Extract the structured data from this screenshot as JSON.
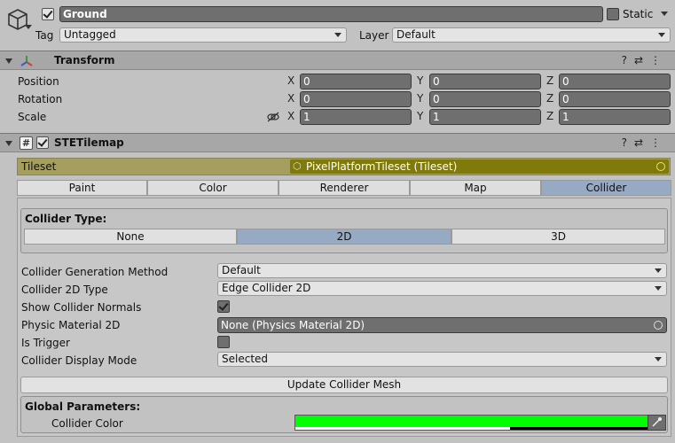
{
  "header": {
    "object_active": true,
    "object_name": "Ground",
    "static_label": "Static",
    "static_checked": false,
    "tag_label": "Tag",
    "tag_value": "Untagged",
    "layer_label": "Layer",
    "layer_value": "Default"
  },
  "transform": {
    "title": "Transform",
    "rows": [
      {
        "label": "Position",
        "x": "0",
        "y": "0",
        "z": "0"
      },
      {
        "label": "Rotation",
        "x": "0",
        "y": "0",
        "z": "0"
      },
      {
        "label": "Scale",
        "x": "1",
        "y": "1",
        "z": "1"
      }
    ],
    "axis_x": "X",
    "axis_y": "Y",
    "axis_z": "Z"
  },
  "stetilemap": {
    "title": "STETilemap",
    "enabled": true,
    "tileset_label": "Tileset",
    "tileset_value": "PixelPlatformTileset (Tileset)",
    "tabs": [
      "Paint",
      "Color",
      "Renderer",
      "Map",
      "Collider"
    ],
    "active_tab": "Collider",
    "collider_type_label": "Collider Type:",
    "collider_types": [
      "None",
      "2D",
      "3D"
    ],
    "active_collider_type": "2D",
    "props": {
      "generation_method_label": "Collider Generation Method",
      "generation_method_value": "Default",
      "collider_2d_type_label": "Collider 2D Type",
      "collider_2d_type_value": "Edge Collider 2D",
      "show_normals_label": "Show Collider Normals",
      "show_normals_checked": true,
      "physics_material_label": "Physic Material 2D",
      "physics_material_value": "None (Physics Material 2D)",
      "is_trigger_label": "Is Trigger",
      "is_trigger_checked": false,
      "display_mode_label": "Collider Display Mode",
      "display_mode_value": "Selected"
    },
    "update_button_label": "Update Collider Mesh",
    "global_params_label": "Global Parameters:",
    "collider_color_label": "Collider Color",
    "collider_color": "#00ff00"
  },
  "colors": {
    "panel": "#c2c2c2",
    "header_bar": "#a7a7a7",
    "active_tab": "#96aac4",
    "tileset_row": "#a49f5f",
    "tileset_field": "#7f7a0a"
  }
}
